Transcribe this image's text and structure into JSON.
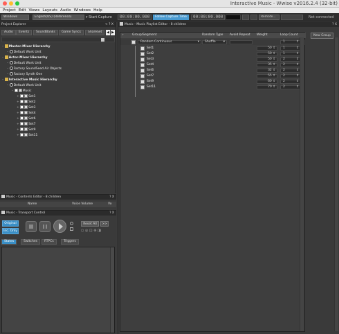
{
  "window": {
    "title": "Interactive Music - Wwise v2016.2.4 (32-bit)",
    "colors": {
      "close": "#ff5f57",
      "minimize": "#febc2e",
      "zoom": "#28c840"
    }
  },
  "menu": [
    "Project",
    "Edit",
    "Views",
    "Layouts",
    "Audio",
    "Windows",
    "Help"
  ],
  "toolbar": {
    "layout_select": "Windows",
    "language_select": "English(US) (Reference)",
    "start_capture": "Start Capture",
    "time_a": "00:00:00.000",
    "follow": "Follow Capture Time",
    "time_b": "00:00:00.000",
    "remote": "Remote...",
    "status": "Not connected"
  },
  "project_explorer": {
    "title": "Project Explorer",
    "controls": "< ? X",
    "tabs": [
      "Audio",
      "Events",
      "SoundBanks",
      "Game Syncs",
      "ShareSet"
    ],
    "tree": [
      {
        "label": "Master-Mixer Hierarchy",
        "level": 0,
        "icon": "folder",
        "bold": true
      },
      {
        "label": "Default Work Unit",
        "level": 1,
        "icon": "work-unit"
      },
      {
        "label": "Actor-Mixer Hierarchy",
        "level": 0,
        "icon": "folder",
        "bold": true
      },
      {
        "label": "Default Work Unit",
        "level": 1,
        "icon": "work-unit"
      },
      {
        "label": "Factory SoundSeed Air Objects",
        "level": 1,
        "icon": "work-unit"
      },
      {
        "label": "Factory Synth One",
        "level": 1,
        "icon": "work-unit"
      },
      {
        "label": "Interactive Music Hierarchy",
        "level": 0,
        "icon": "folder",
        "bold": true
      },
      {
        "label": "Default Work Unit",
        "level": 1,
        "icon": "work-unit"
      },
      {
        "label": "Music",
        "level": 2,
        "icon": "playlist"
      },
      {
        "label": "Set1",
        "level": 3,
        "icon": "segment"
      },
      {
        "label": "Set2",
        "level": 3,
        "icon": "segment"
      },
      {
        "label": "Set3",
        "level": 3,
        "icon": "segment"
      },
      {
        "label": "Set4",
        "level": 3,
        "icon": "segment"
      },
      {
        "label": "Set6",
        "level": 3,
        "icon": "segment"
      },
      {
        "label": "Set7",
        "level": 3,
        "icon": "segment"
      },
      {
        "label": "Set9",
        "level": 3,
        "icon": "segment"
      },
      {
        "label": "Set11",
        "level": 3,
        "icon": "segment"
      }
    ]
  },
  "contents_editor": {
    "title": "Music - Contents Editor - 8 children",
    "controls": "? X",
    "col_name": "Name",
    "col_volume": "Voice Volume",
    "col_extra": "Vo"
  },
  "transport": {
    "title": "Music - Transport Control",
    "controls": "? X",
    "original": "Original",
    "inc_only": "Inc. Only",
    "reset_all": "Reset All",
    "tabs": [
      "States",
      "Switches",
      "RTPCs",
      "Triggers"
    ]
  },
  "playlist_editor": {
    "title": "Music - Music Playlist Editor - 8 children",
    "controls": "? X",
    "headers": {
      "group": "Group/Segment",
      "random_type": "Random Type",
      "avoid_repeat": "Avoid Repeat",
      "weight": "Weight",
      "loop_count": "Loop Count"
    },
    "group": {
      "label": "Random Continuous",
      "random_type": "Shuffle",
      "loop": "1"
    },
    "new_group": "New Group",
    "segments": [
      {
        "name": "Set1",
        "weight": "50",
        "loop": "1"
      },
      {
        "name": "Set2",
        "weight": "50",
        "loop": "1"
      },
      {
        "name": "Set3",
        "weight": "50",
        "loop": "2"
      },
      {
        "name": "Set4",
        "weight": "35",
        "loop": "2"
      },
      {
        "name": "Set6",
        "weight": "32",
        "loop": "2"
      },
      {
        "name": "Set7",
        "weight": "55",
        "loop": "2"
      },
      {
        "name": "Set9",
        "weight": "60",
        "loop": "2"
      },
      {
        "name": "Set11",
        "weight": "70",
        "loop": "2"
      }
    ]
  }
}
